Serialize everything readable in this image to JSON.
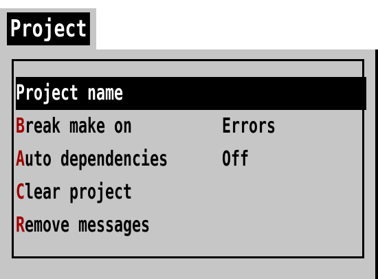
{
  "menu": {
    "title": "Project"
  },
  "items": [
    {
      "hotkey": "P",
      "rest": "roject name",
      "value": "",
      "selected": true
    },
    {
      "hotkey": "B",
      "rest": "reak make on",
      "value": "Errors",
      "selected": false
    },
    {
      "hotkey": "A",
      "rest": "uto dependencies",
      "value": "Off",
      "selected": false
    },
    {
      "hotkey": "C",
      "rest": "lear project",
      "value": "",
      "selected": false
    },
    {
      "hotkey": "R",
      "rest": "emove messages",
      "value": "",
      "selected": false
    }
  ],
  "colors": {
    "background": "#c6c6c6",
    "hotkey": "#a40000",
    "selection": "#000000",
    "text": "#000000"
  }
}
